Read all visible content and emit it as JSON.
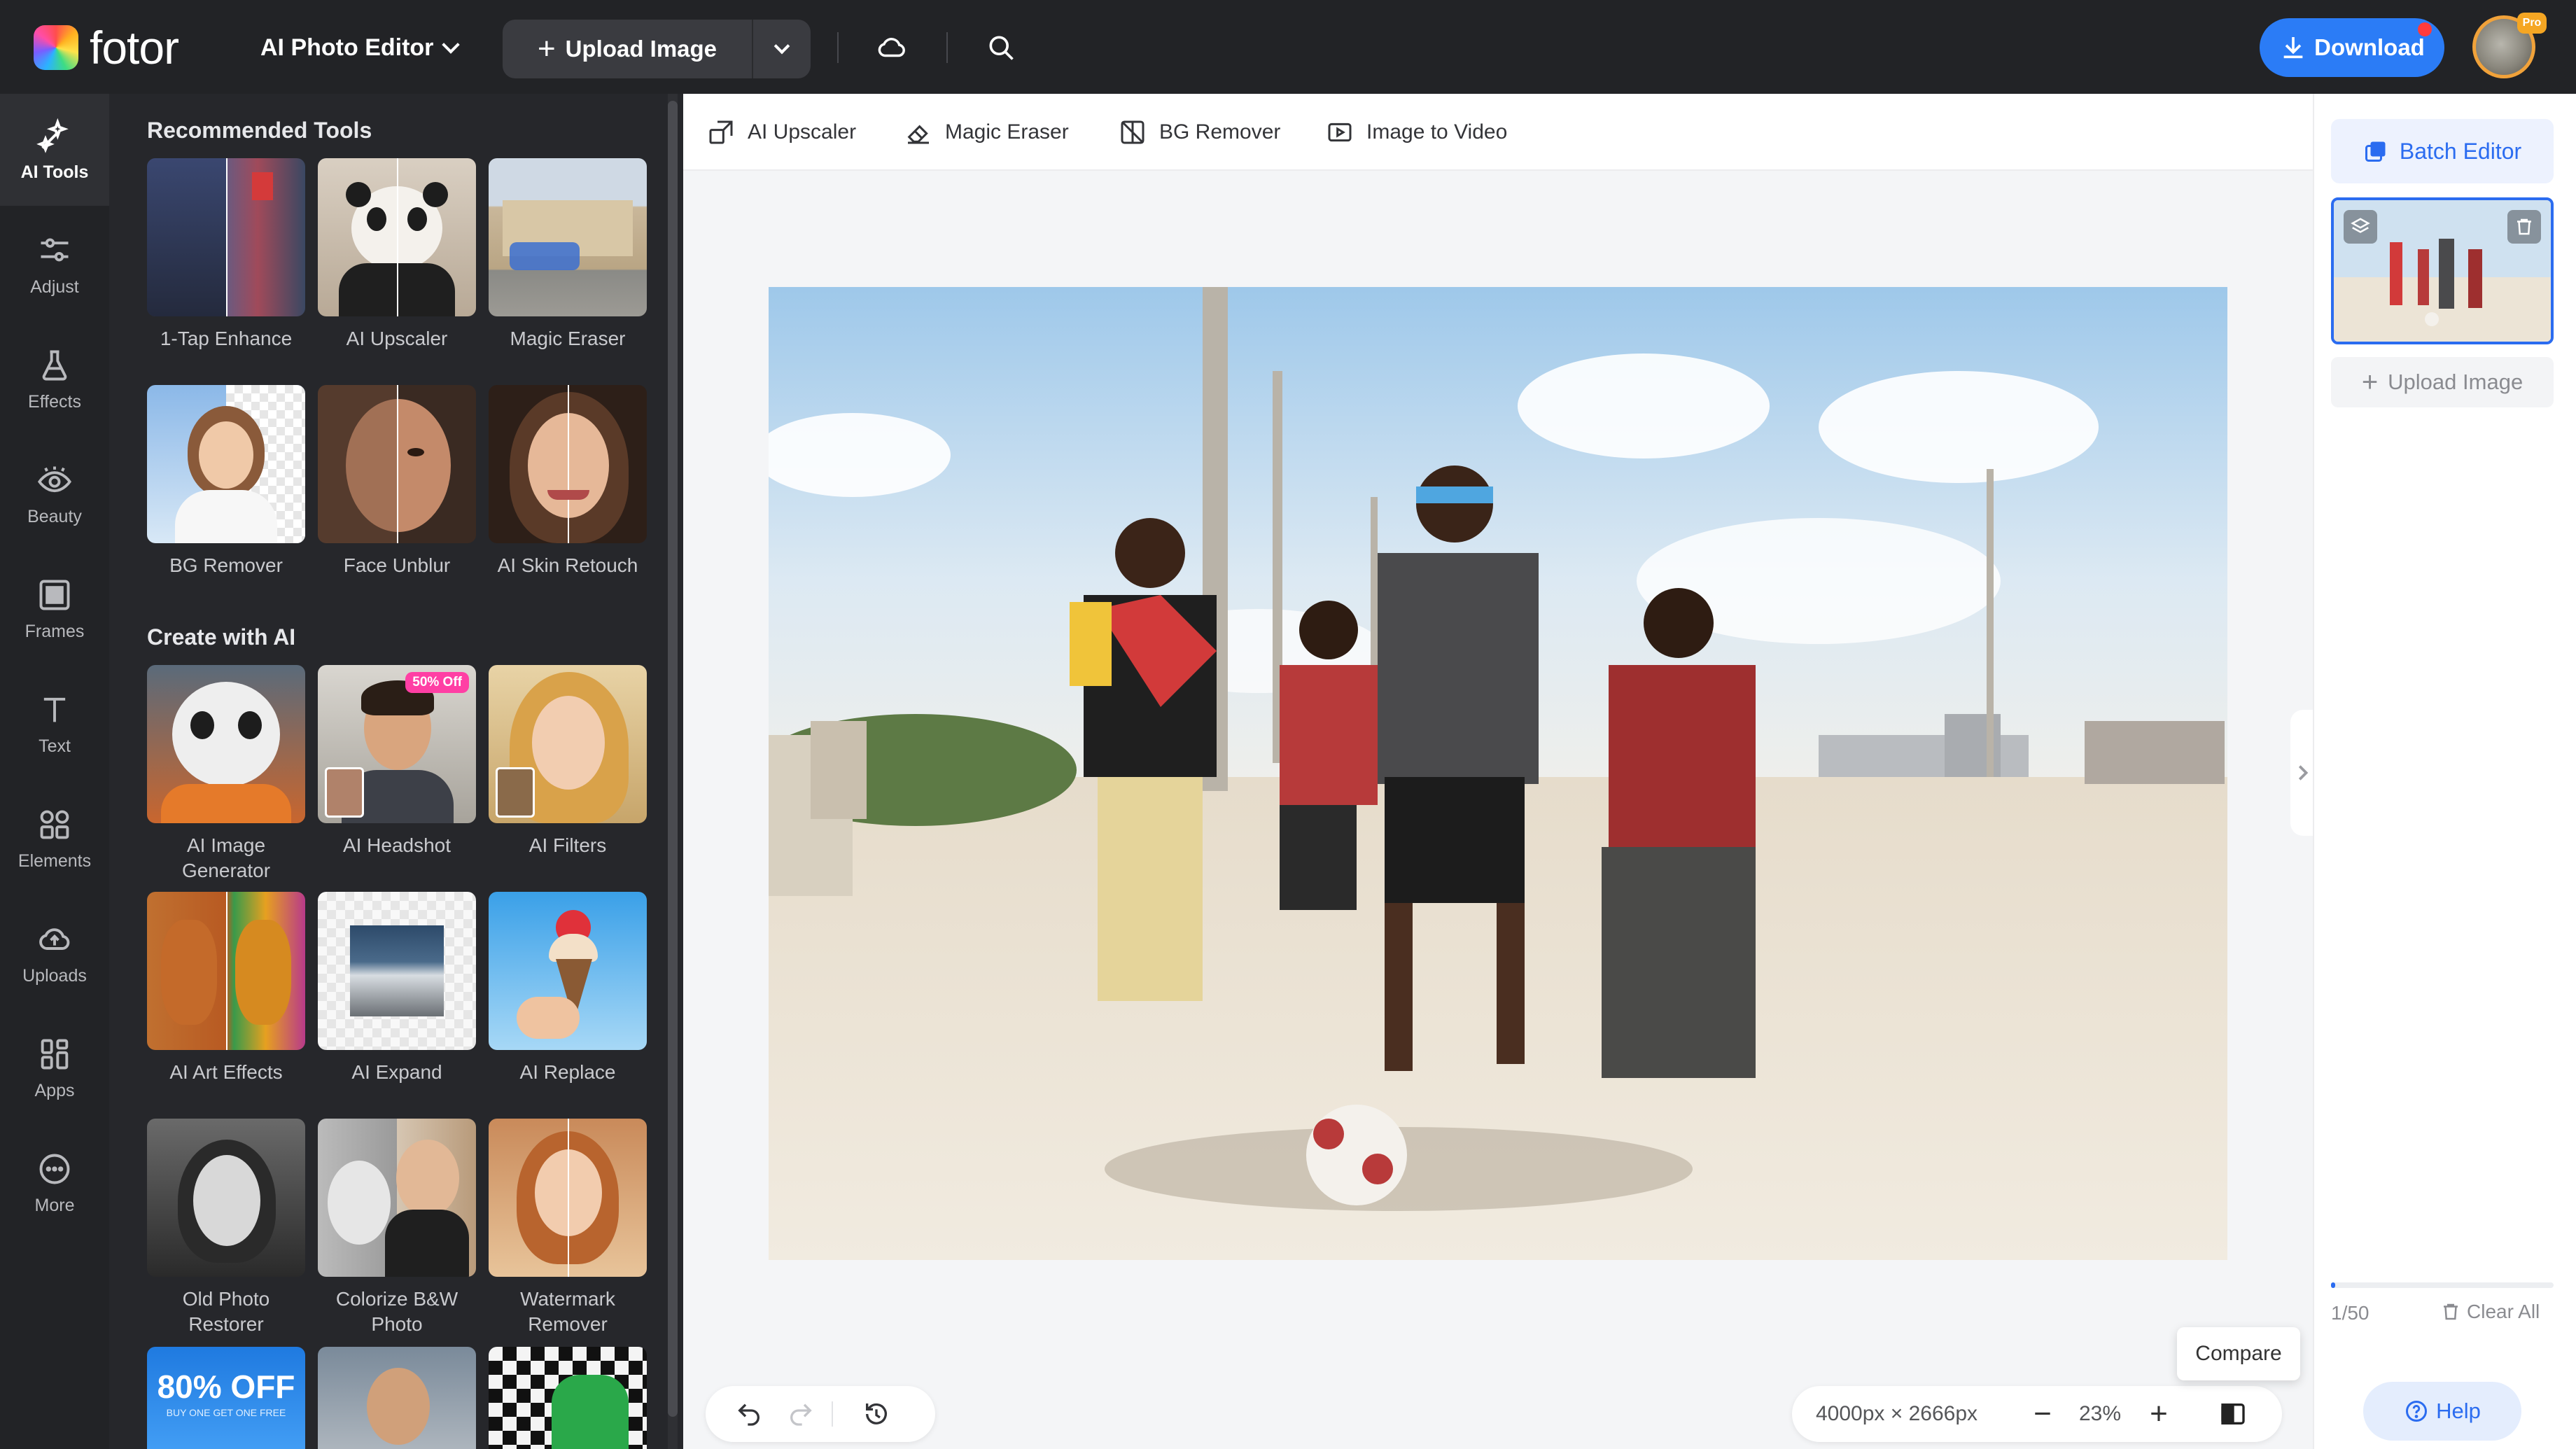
{
  "app": {
    "logo_text": "fotor",
    "editor_menu_label": "AI Photo Editor",
    "upload_label": "Upload Image",
    "download_label": "Download",
    "avatar_badge": "Pro",
    "accent_color": "#2b7cf6"
  },
  "rail": {
    "items": [
      {
        "label": "AI Tools",
        "icon": "ai-tools-icon"
      },
      {
        "label": "Adjust",
        "icon": "sliders-icon"
      },
      {
        "label": "Effects",
        "icon": "flask-icon"
      },
      {
        "label": "Beauty",
        "icon": "eye-icon"
      },
      {
        "label": "Frames",
        "icon": "frame-icon"
      },
      {
        "label": "Text",
        "icon": "text-icon"
      },
      {
        "label": "Elements",
        "icon": "shapes-icon"
      },
      {
        "label": "Uploads",
        "icon": "cloud-upload-icon"
      },
      {
        "label": "Apps",
        "icon": "apps-icon"
      },
      {
        "label": "More",
        "icon": "more-icon"
      }
    ]
  },
  "panel": {
    "recommended_title": "Recommended Tools",
    "create_title": "Create with AI",
    "recommended": [
      {
        "label": "1-Tap Enhance"
      },
      {
        "label": "AI Upscaler"
      },
      {
        "label": "Magic Eraser"
      },
      {
        "label": "BG Remover"
      },
      {
        "label": "Face Unblur"
      },
      {
        "label": "AI Skin Retouch"
      }
    ],
    "create": [
      {
        "label": "AI Image Generator"
      },
      {
        "label": "AI Headshot",
        "tag": "50% Off"
      },
      {
        "label": "AI Filters"
      },
      {
        "label": "AI Art Effects"
      },
      {
        "label": "AI Expand"
      },
      {
        "label": "AI Replace"
      },
      {
        "label": "Old Photo Restorer"
      },
      {
        "label": "Colorize B&W Photo"
      },
      {
        "label": "Watermark Remover"
      }
    ],
    "promo_text": "80% OFF",
    "promo_sub": "BUY ONE GET ONE FREE"
  },
  "quickbar": {
    "items": [
      {
        "label": "AI Upscaler"
      },
      {
        "label": "Magic Eraser"
      },
      {
        "label": "BG Remover"
      },
      {
        "label": "Image to Video"
      }
    ]
  },
  "canvas": {
    "dimensions": "4000px × 2666px",
    "zoom": "23%",
    "compare_tooltip": "Compare"
  },
  "right_sidebar": {
    "batch_label": "Batch Editor",
    "upload_label": "Upload Image",
    "count": "1/50",
    "clear_label": "Clear All",
    "help_label": "Help",
    "progress": 0.02
  }
}
